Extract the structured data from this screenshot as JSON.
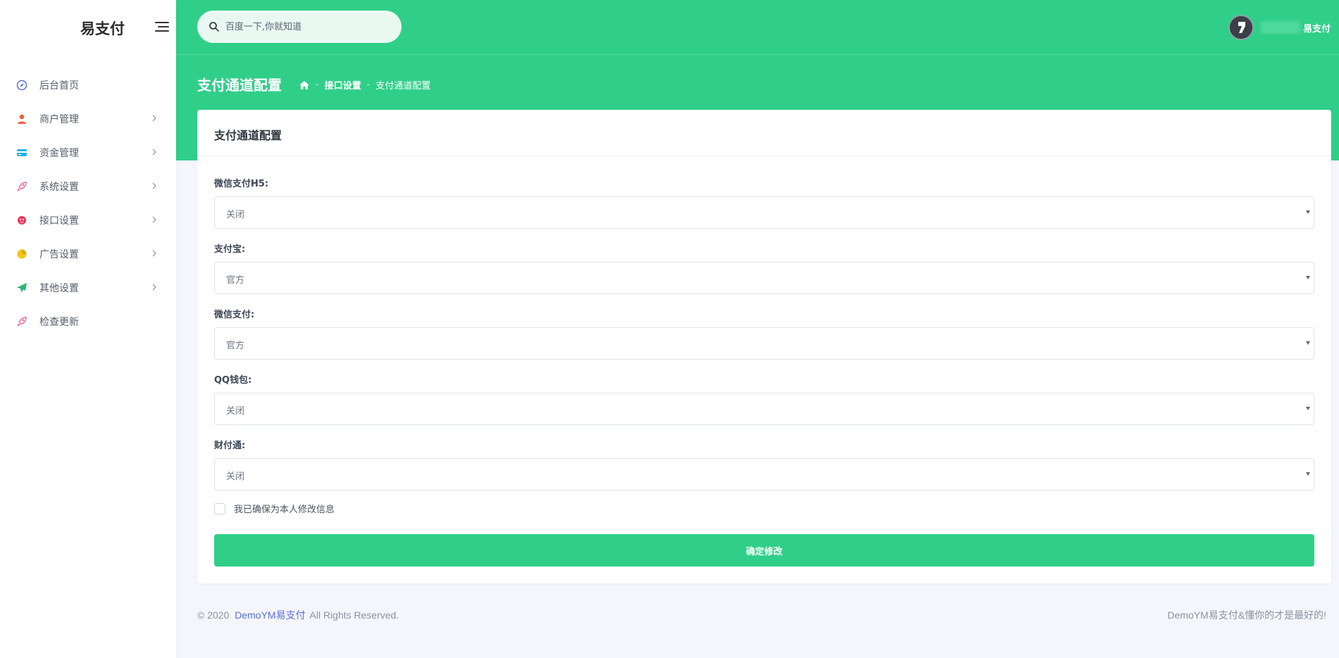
{
  "brand": {
    "name": "易支付"
  },
  "search": {
    "placeholder": "百度一下,你就知道"
  },
  "user": {
    "name": "易支付"
  },
  "sidebar": {
    "items": [
      {
        "label": "后台首页",
        "icon": "compass-icon",
        "color": "#5a6fd6",
        "has_submenu": false
      },
      {
        "label": "商户管理",
        "icon": "user-icon",
        "color": "#f0603c",
        "has_submenu": true
      },
      {
        "label": "资金管理",
        "icon": "card-icon",
        "color": "#1eb4e6",
        "has_submenu": true
      },
      {
        "label": "系统设置",
        "icon": "rocket-icon",
        "color": "#f06292",
        "has_submenu": true
      },
      {
        "label": "接口设置",
        "icon": "bug-icon",
        "color": "#e8345a",
        "has_submenu": true
      },
      {
        "label": "广告设置",
        "icon": "pie-icon",
        "color": "#f5c518",
        "has_submenu": true
      },
      {
        "label": "其他设置",
        "icon": "send-icon",
        "color": "#2bb673",
        "has_submenu": true
      },
      {
        "label": "检查更新",
        "icon": "rocket-icon",
        "color": "#f06292",
        "has_submenu": false
      }
    ]
  },
  "header": {
    "page_title": "支付通道配置",
    "breadcrumb": [
      "接口设置",
      "支付通道配置"
    ]
  },
  "card": {
    "title": "支付通道配置",
    "fields": [
      {
        "label": "微信支付H5:",
        "value": "关闭"
      },
      {
        "label": "支付宝:",
        "value": "官方"
      },
      {
        "label": "微信支付:",
        "value": "官方"
      },
      {
        "label": "QQ钱包:",
        "value": "关闭"
      },
      {
        "label": "财付通:",
        "value": "关闭"
      }
    ],
    "confirm_label": "我已确保为本人修改信息",
    "submit_label": "确定修改"
  },
  "footer": {
    "copyright": "© 2020",
    "brand_link": "DemoYM易支付",
    "rights": "All Rights Reserved.",
    "right_text": "DemoYM易支付&懂你的才是最好的!"
  },
  "colors": {
    "accent": "#30cf89",
    "link": "#5a6fd6"
  }
}
